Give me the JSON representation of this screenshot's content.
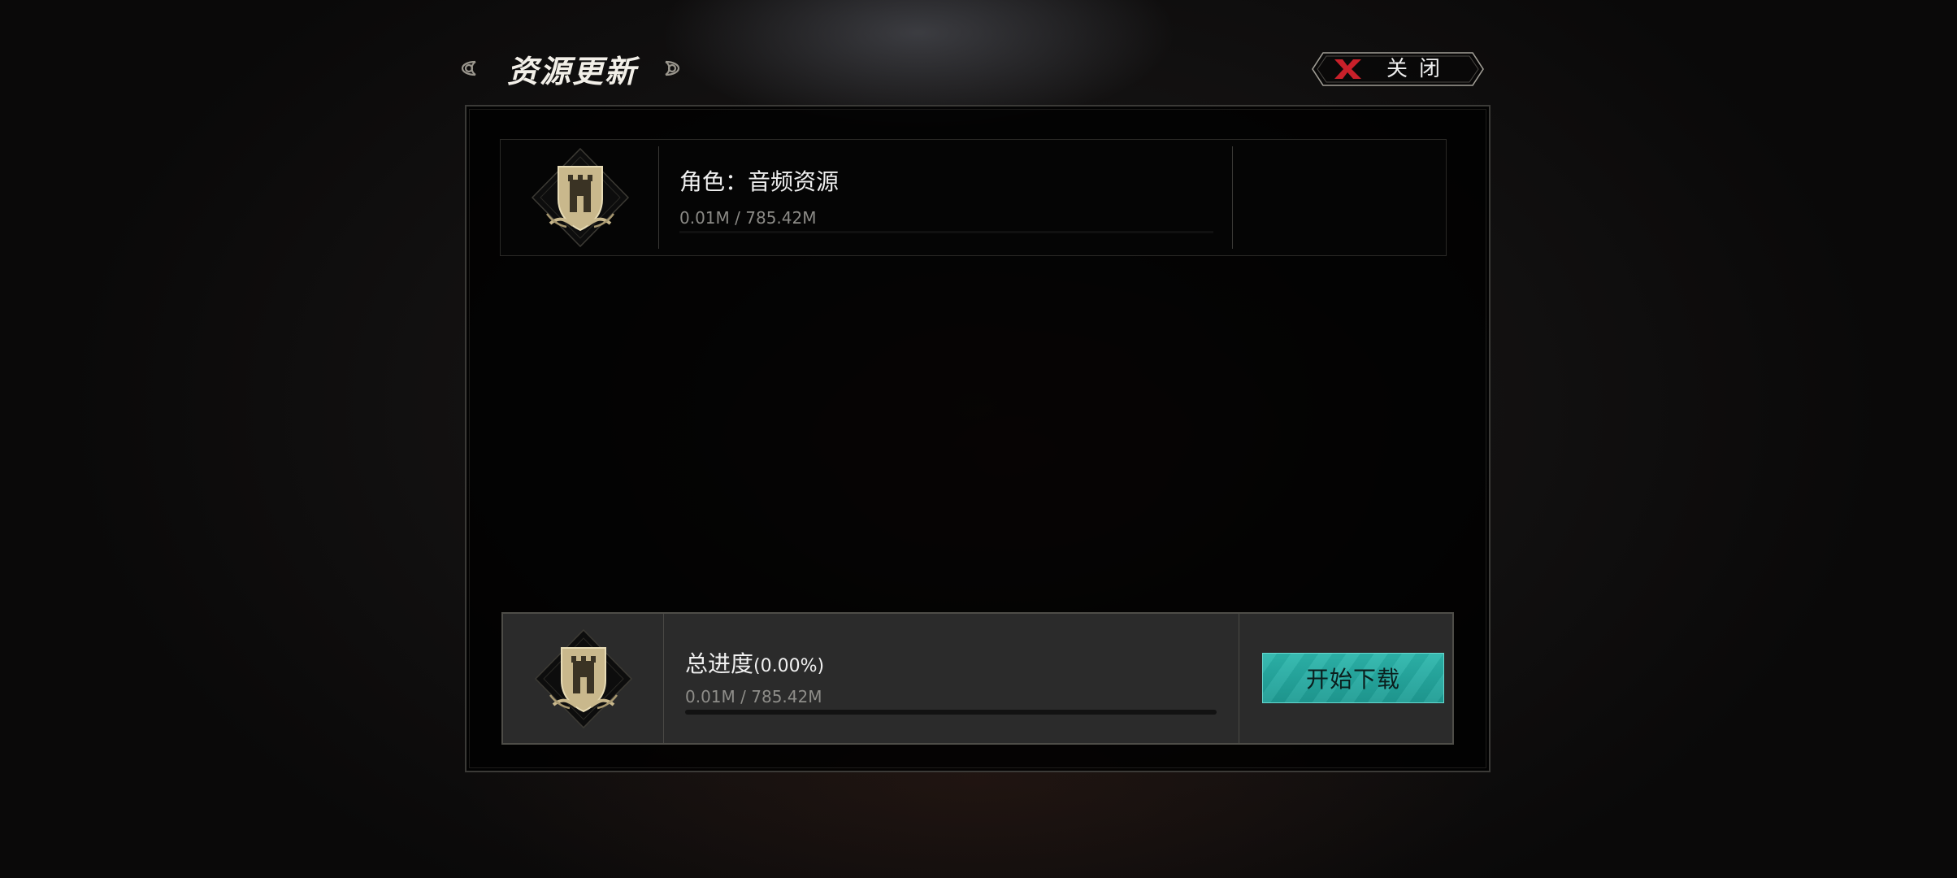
{
  "header": {
    "title": "资源更新",
    "left_icon": "triquetra-left-icon",
    "right_icon": "triquetra-right-icon"
  },
  "close_button": {
    "label": "关闭",
    "icon": "close-x-icon",
    "icon_color": "#c8202a"
  },
  "items": [
    {
      "name": "角色：音频资源",
      "size": "0.01M / 785.42M",
      "progress": 0.0,
      "icon": "castle-shield-emblem-icon"
    }
  ],
  "summary": {
    "title": "总进度",
    "percent": "(0.00%)",
    "size": "0.01M / 785.42M",
    "progress": 0.0,
    "icon": "castle-shield-emblem-icon",
    "start_button_label": "开始下载",
    "accent_color": "#25aaa1"
  }
}
